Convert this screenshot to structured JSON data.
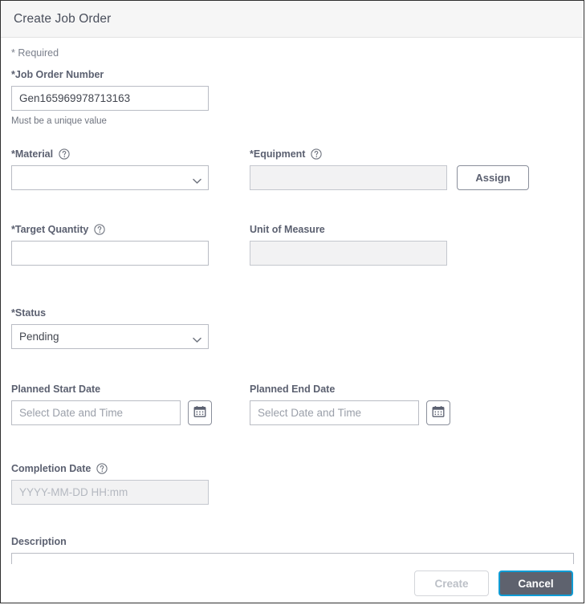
{
  "dialog": {
    "title": "Create Job Order",
    "required_note": "* Required"
  },
  "fields": {
    "job_order_number": {
      "label": "*Job Order Number",
      "value": "Gen165969978713163",
      "helper": "Must be a unique value"
    },
    "material": {
      "label": "*Material",
      "value": "",
      "help_icon": "help-circle-icon",
      "chevron_icon": "chevron-down-icon"
    },
    "equipment": {
      "label": "*Equipment",
      "value": "",
      "help_icon": "help-circle-icon",
      "assign_label": "Assign"
    },
    "target_quantity": {
      "label": "*Target Quantity",
      "value": "",
      "help_icon": "help-circle-icon"
    },
    "unit_of_measure": {
      "label": "Unit of Measure",
      "value": ""
    },
    "status": {
      "label": "*Status",
      "value": "Pending",
      "options": [
        "Pending"
      ],
      "chevron_icon": "chevron-down-icon"
    },
    "planned_start_date": {
      "label": "Planned Start Date",
      "value": "",
      "placeholder": "Select Date and Time",
      "calendar_icon": "calendar-icon"
    },
    "planned_end_date": {
      "label": "Planned End Date",
      "value": "",
      "placeholder": "Select Date and Time",
      "calendar_icon": "calendar-icon"
    },
    "completion_date": {
      "label": "Completion Date",
      "value": "",
      "placeholder": "YYYY-MM-DD HH:mm",
      "help_icon": "help-circle-icon"
    },
    "description": {
      "label": "Description",
      "value": ""
    }
  },
  "footer": {
    "create_label": "Create",
    "cancel_label": "Cancel"
  },
  "colors": {
    "header_bg": "#f6f6f6",
    "label_text": "#5b6070",
    "border": "#b9bcc4",
    "disabled_bg": "#f2f2f3",
    "cancel_bg": "#5e626e",
    "focus_ring": "#0f9cd5"
  }
}
